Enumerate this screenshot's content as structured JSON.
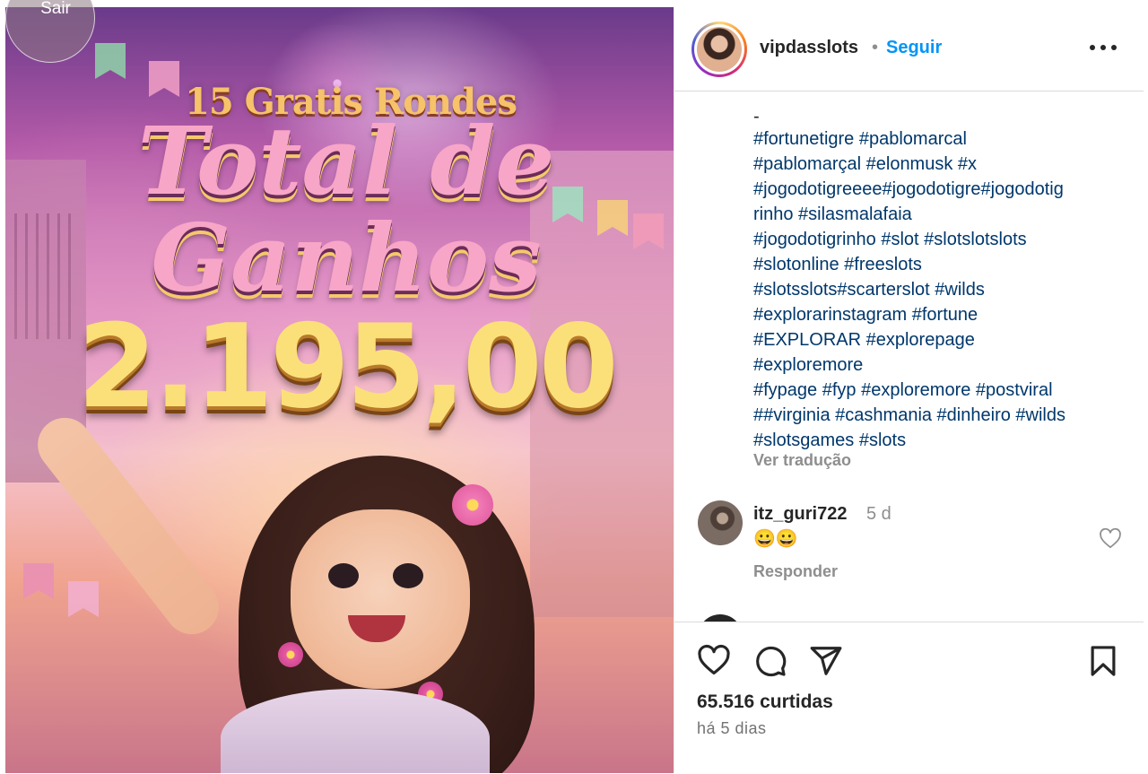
{
  "image": {
    "exit_label": "Sair",
    "promo_subtitle": "15 Gratis Rondes",
    "promo_title_line1": "Total de",
    "promo_title_line2": "Ganhos",
    "promo_amount": "2.195,00"
  },
  "header": {
    "username": "vipdasslots",
    "separator": "•",
    "follow_label": "Seguir",
    "more_icon": "more-horizontal-icon"
  },
  "caption": {
    "dash": "-",
    "hashtag_lines": [
      "#fortunetigre #pablomarcal",
      "#pablomarçal #elonmusk #x",
      "#jogodotigreeee#jogodotigre#jogodotig",
      "rinho #silasmalafaia",
      "#jogodotigrinho #slot #slotslotslots",
      "#slotonline #freeslots",
      "#slotsslots#scarterslot #wilds",
      "#explorarinstagram #fortune",
      "#EXPLORAR #explorepage",
      "#exploremore",
      "#fypage #fyp #exploremore #postviral",
      "##virginia #cashmania #dinheiro #wilds",
      "#slotsgames #slots"
    ],
    "see_translation": "Ver tradução"
  },
  "comment": {
    "username": "itz_guri722",
    "time": "5 d",
    "text": "😀😀",
    "reply_label": "Responder"
  },
  "actions": {
    "icons": [
      "heart-icon",
      "comment-icon",
      "share-icon",
      "bookmark-icon"
    ],
    "likes": "65.516 curtidas",
    "posted": "há 5 dias"
  },
  "colors": {
    "link": "#00376b",
    "follow": "#0095f6",
    "muted": "#8e8e8e",
    "text": "#262626"
  }
}
